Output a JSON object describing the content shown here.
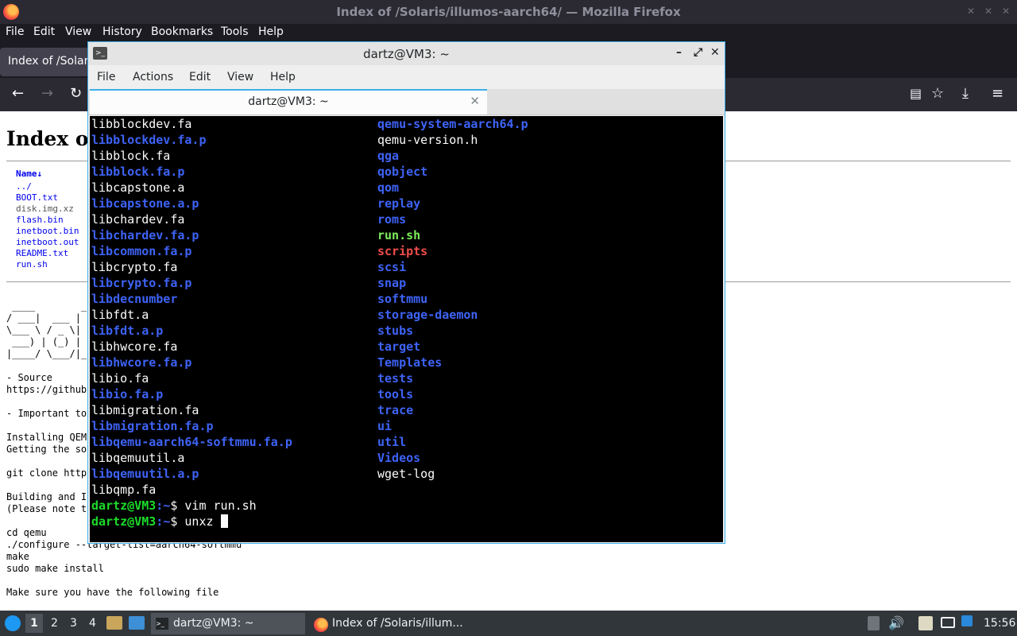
{
  "firefox": {
    "window_title": "Index of /Solaris/illumos-aarch64/ — Mozilla Firefox",
    "menu": [
      "File",
      "Edit",
      "View",
      "History",
      "Bookmarks",
      "Tools",
      "Help"
    ],
    "tab_title": "Index of /Solaris/illumos-aarch64/",
    "page": {
      "heading": "Index of /Solaris/illumos-aarch64/",
      "column_header": "Name↓",
      "files": [
        "../",
        "BOOT.txt",
        "disk.img.xz",
        "flash.bin",
        "inetboot.bin",
        "inetboot.out",
        "README.txt",
        "run.sh"
      ],
      "pre_lines": [
        " ____        _",
        "/ ___|  ___ | |",
        "\\___ \\ / _ \\| |",
        " ___) | (_) | |",
        "|____/ \\___/|_|",
        "",
        "- Source",
        "https://github",
        "",
        "- Important to",
        "",
        "Installing QEM",
        "Getting the so",
        "",
        "git clone http",
        "",
        "Building and I",
        "(Please note t",
        "",
        "cd qemu",
        "./configure --target-list=aarch64-softmmu",
        "make",
        "sudo make install",
        "",
        "Make sure you have the following file"
      ]
    }
  },
  "terminal": {
    "window_title": "dartz@VM3: ~",
    "menu": [
      "File",
      "Actions",
      "Edit",
      "View",
      "Help"
    ],
    "tab_title": "dartz@VM3: ~",
    "left_column": [
      {
        "name": "libblockdev.fa",
        "kind": "file"
      },
      {
        "name": "libblockdev.fa.p",
        "kind": "dir"
      },
      {
        "name": "libblock.fa",
        "kind": "file"
      },
      {
        "name": "libblock.fa.p",
        "kind": "dir"
      },
      {
        "name": "libcapstone.a",
        "kind": "file"
      },
      {
        "name": "libcapstone.a.p",
        "kind": "dir"
      },
      {
        "name": "libchardev.fa",
        "kind": "file"
      },
      {
        "name": "libchardev.fa.p",
        "kind": "dir"
      },
      {
        "name": "libcommon.fa.p",
        "kind": "dir"
      },
      {
        "name": "libcrypto.fa",
        "kind": "file"
      },
      {
        "name": "libcrypto.fa.p",
        "kind": "dir"
      },
      {
        "name": "libdecnumber",
        "kind": "dir"
      },
      {
        "name": "libfdt.a",
        "kind": "file"
      },
      {
        "name": "libfdt.a.p",
        "kind": "dir"
      },
      {
        "name": "libhwcore.fa",
        "kind": "file"
      },
      {
        "name": "libhwcore.fa.p",
        "kind": "dir"
      },
      {
        "name": "libio.fa",
        "kind": "file"
      },
      {
        "name": "libio.fa.p",
        "kind": "dir"
      },
      {
        "name": "libmigration.fa",
        "kind": "file"
      },
      {
        "name": "libmigration.fa.p",
        "kind": "dir"
      },
      {
        "name": "libqemu-aarch64-softmmu.fa.p",
        "kind": "dir"
      },
      {
        "name": "libqemuutil.a",
        "kind": "file"
      },
      {
        "name": "libqemuutil.a.p",
        "kind": "dir"
      },
      {
        "name": "libqmp.fa",
        "kind": "file"
      }
    ],
    "right_column": [
      {
        "name": "qemu-system-aarch64.p",
        "kind": "dir"
      },
      {
        "name": "qemu-version.h",
        "kind": "file"
      },
      {
        "name": "qga",
        "kind": "dir"
      },
      {
        "name": "qobject",
        "kind": "dir"
      },
      {
        "name": "qom",
        "kind": "dir"
      },
      {
        "name": "replay",
        "kind": "dir"
      },
      {
        "name": "roms",
        "kind": "dir"
      },
      {
        "name": "run.sh",
        "kind": "exec"
      },
      {
        "name": "scripts",
        "kind": "red"
      },
      {
        "name": "scsi",
        "kind": "dir"
      },
      {
        "name": "snap",
        "kind": "dir"
      },
      {
        "name": "softmmu",
        "kind": "dir"
      },
      {
        "name": "storage-daemon",
        "kind": "dir"
      },
      {
        "name": "stubs",
        "kind": "dir"
      },
      {
        "name": "target",
        "kind": "dir"
      },
      {
        "name": "Templates",
        "kind": "dir"
      },
      {
        "name": "tests",
        "kind": "dir"
      },
      {
        "name": "tools",
        "kind": "dir"
      },
      {
        "name": "trace",
        "kind": "dir"
      },
      {
        "name": "ui",
        "kind": "dir"
      },
      {
        "name": "util",
        "kind": "dir"
      },
      {
        "name": "Videos",
        "kind": "dir"
      },
      {
        "name": "wget-log",
        "kind": "file"
      }
    ],
    "prompt_user": "dartz@VM3",
    "prompt_path": ":~",
    "prompt_symbol": "$ ",
    "history": [
      {
        "cmd": "vim run.sh"
      },
      {
        "cmd": "unxz "
      }
    ]
  },
  "taskbar": {
    "workspaces": [
      "1",
      "2",
      "3",
      "4"
    ],
    "active_workspace": "1",
    "tasks": [
      "dartz@VM3: ~",
      "Index of /Solaris/illum..."
    ],
    "clock": "15:56"
  },
  "colors": {
    "file": "#fcfcfc",
    "dir": "#3e63f6",
    "exec": "#7ded5a",
    "red": "#f24c4c",
    "prompt_user": "#1cdc2a",
    "link": "#0000ee",
    "accent": "#3daee9"
  }
}
